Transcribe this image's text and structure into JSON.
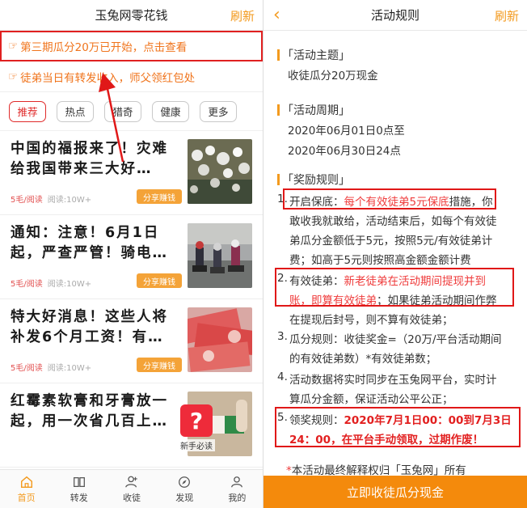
{
  "left": {
    "header": {
      "title": "玉兔网零花钱",
      "refresh_label": "刷新"
    },
    "notices": [
      {
        "icon": "pointing-hand-icon",
        "text": "第三期瓜分20万已开始，点击查看"
      },
      {
        "icon": "pointing-hand-icon",
        "text": "徒弟当日有转发收入，师父领红包处"
      }
    ],
    "tabs": [
      {
        "label": "推荐",
        "active": true
      },
      {
        "label": "热点",
        "active": false
      },
      {
        "label": "猎奇",
        "active": false
      },
      {
        "label": "健康",
        "active": false
      },
      {
        "label": "更多",
        "active": false
      }
    ],
    "articles": [
      {
        "title": "中国的福报来了！灾难给我国带来三大好…",
        "price": "5毛/阅读",
        "reads": "阅读:10W+",
        "share_label": "分享赚钱"
      },
      {
        "title": "通知：注意！6月1日起，严查严管！骑电…",
        "price": "5毛/阅读",
        "reads": "阅读:10W+",
        "share_label": "分享赚钱"
      },
      {
        "title": "特大好消息！这些人将补发6个月工资！有…",
        "price": "5毛/阅读",
        "reads": "阅读:10W+",
        "share_label": "分享赚钱"
      },
      {
        "title": "红霉素软膏和牙膏放一起，用一次省几百上…",
        "price": "",
        "reads": "",
        "share_label": ""
      }
    ],
    "help": {
      "icon": "question-mark-icon",
      "glyph": "?",
      "label": "新手必读"
    },
    "bottom_nav": [
      {
        "label": "首页",
        "icon": "home-icon",
        "active": true
      },
      {
        "label": "转发",
        "icon": "book-icon",
        "active": false
      },
      {
        "label": "收徒",
        "icon": "person-add-icon",
        "active": false
      },
      {
        "label": "发现",
        "icon": "compass-icon",
        "active": false
      },
      {
        "label": "我的",
        "icon": "user-icon",
        "active": false
      }
    ],
    "colors": {
      "accent": "#f39a1e",
      "notice": "#f0741c",
      "annotation": "#e01818"
    }
  },
  "right": {
    "header": {
      "back_icon": "chevron-left-icon",
      "back_glyph": "‹",
      "title": "活动规则",
      "refresh_label": "刷新"
    },
    "sections": {
      "theme_heading": "「活动主题」",
      "theme_text": "收徒瓜分20万现金",
      "period_heading": "「活动周期」",
      "period_start": "2020年06月01日0点至",
      "period_end": "2020年06月30日24点",
      "rules_heading": "「奖励规则」"
    },
    "rule1": {
      "num": "1.",
      "l1_a": "开启保底：",
      "l1_b": "每个有效徒弟5元保底",
      "l1_c": "措施，你",
      "l2": "敢收我就敢给，活动结束后，如每个有效徒",
      "l3": "弟瓜分金额低于5元，按照5元/有效徒弟计",
      "l4": "费；如高于5元则按照高金额金额计费"
    },
    "rule2": {
      "num": "2.",
      "l1_a": "有效徒弟：",
      "l1_b": "新老徒弟在活动期间提现并到",
      "l2_a": "账，即算有效徒弟",
      "l2_b": "；如果徒弟活动期间作弊",
      "l3": "在提现后封号，则不算有效徒弟；"
    },
    "rule3": {
      "num": "3.",
      "l1": "瓜分规则：收徒奖金=（20万/平台活动期间",
      "l2": "的有效徒弟数）*有效徒弟数；"
    },
    "rule4": {
      "num": "4.",
      "l1": "活动数据将实时同步在玉兔网平台，实时计",
      "l2": "算瓜分金额，保证活动公平公正；"
    },
    "rule5": {
      "num": "5.",
      "l1_a": "领奖规则：",
      "l1_b": "2020年7月1日00：00到7月3日",
      "l2": "24：00，在平台手动领取，过期作废！"
    },
    "footnote_star": "*",
    "footnote": "本活动最终解释权归「玉兔网」所有",
    "cta_label": "立即收徒瓜分现金"
  }
}
